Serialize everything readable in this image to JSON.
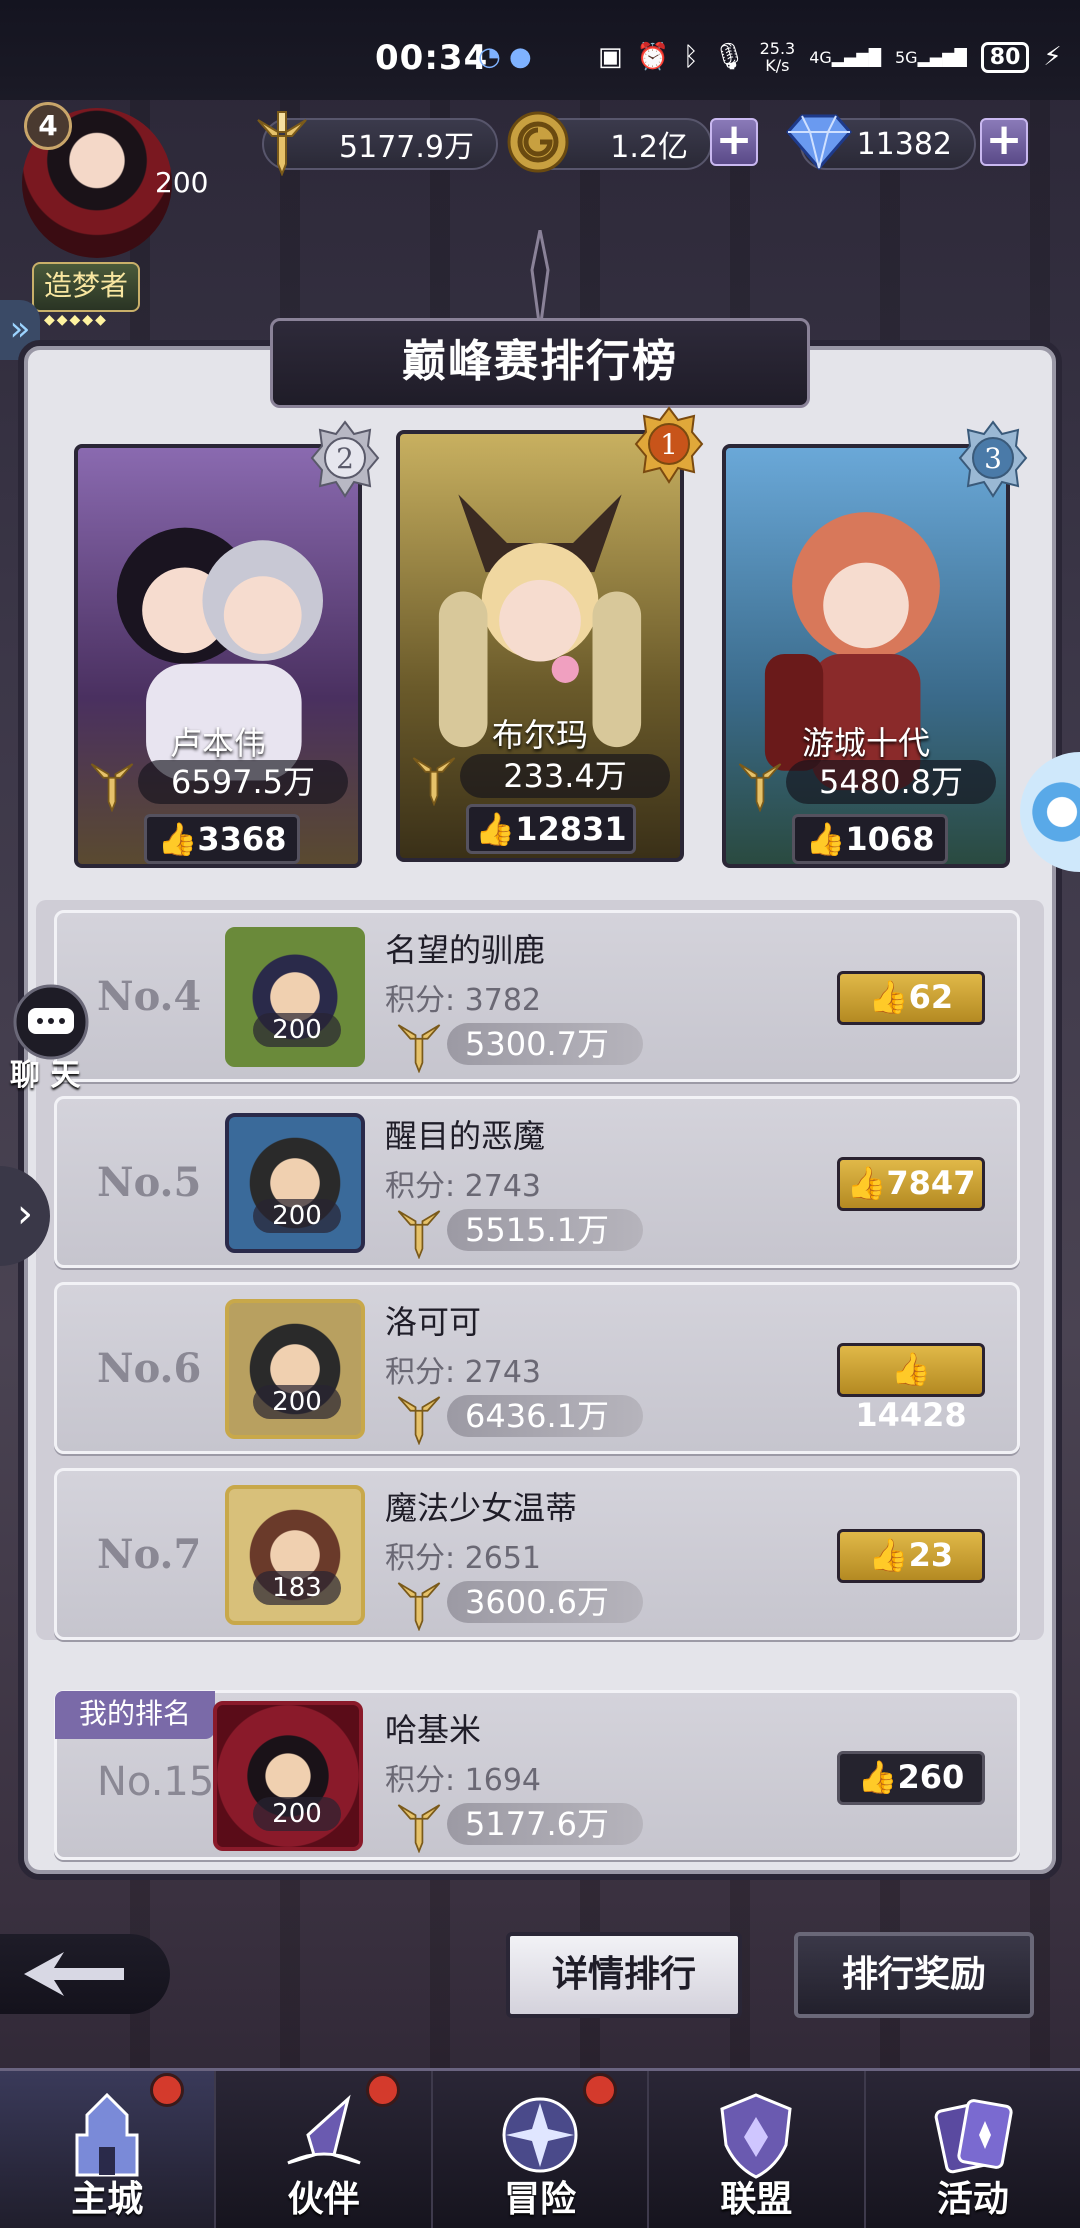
{
  "status_bar": {
    "time": "00:34",
    "net_speed_value": "25.3",
    "net_speed_unit": "K/s",
    "signal_1": "4G",
    "signal_2": "5G",
    "battery": "80"
  },
  "header": {
    "player_level_badge": "4",
    "player_level": "200",
    "player_title": "造梦者",
    "power": "5177.9万",
    "gold": "1.2亿",
    "diamonds": "11382"
  },
  "panel": {
    "title": "巅峰赛排行榜"
  },
  "podium": [
    {
      "rank": "2",
      "name": "卢本伟",
      "power": "6597.5万",
      "likes": "3368",
      "color": "#6a4a8a"
    },
    {
      "rank": "1",
      "name": "布尔玛",
      "power": "233.4万",
      "likes": "12831",
      "color": "#8a7a3a"
    },
    {
      "rank": "3",
      "name": "游城十代",
      "power": "5480.8万",
      "likes": "1068",
      "color": "#3a6a8a"
    }
  ],
  "ranking": [
    {
      "rank": "No.4",
      "name": "名望的驯鹿",
      "score_label": "积分:",
      "score": "3782",
      "level": "200",
      "power": "5300.7万",
      "likes": "62"
    },
    {
      "rank": "No.5",
      "name": "醒目的恶魔",
      "score_label": "积分:",
      "score": "2743",
      "level": "200",
      "power": "5515.1万",
      "likes": "7847"
    },
    {
      "rank": "No.6",
      "name": "洛可可",
      "score_label": "积分:",
      "score": "2743",
      "level": "200",
      "power": "6436.1万",
      "likes": "14428"
    },
    {
      "rank": "No.7",
      "name": "魔法少女温蒂",
      "score_label": "积分:",
      "score": "2651",
      "level": "183",
      "power": "3600.6万",
      "likes": "23"
    }
  ],
  "my_rank": {
    "tag": "我的排名",
    "rank": "No.15",
    "name": "哈基米",
    "score_label": "积分:",
    "score": "1694",
    "level": "200",
    "power": "5177.6万",
    "likes": "260"
  },
  "side": {
    "chat_label": "聊 天"
  },
  "buttons": {
    "detail_rank": "详情排行",
    "rank_reward": "排行奖励"
  },
  "nav": [
    {
      "label": "主城",
      "badge": true
    },
    {
      "label": "伙伴",
      "badge": true
    },
    {
      "label": "冒险",
      "badge": true
    },
    {
      "label": "联盟",
      "badge": false
    },
    {
      "label": "活动",
      "badge": false
    }
  ]
}
